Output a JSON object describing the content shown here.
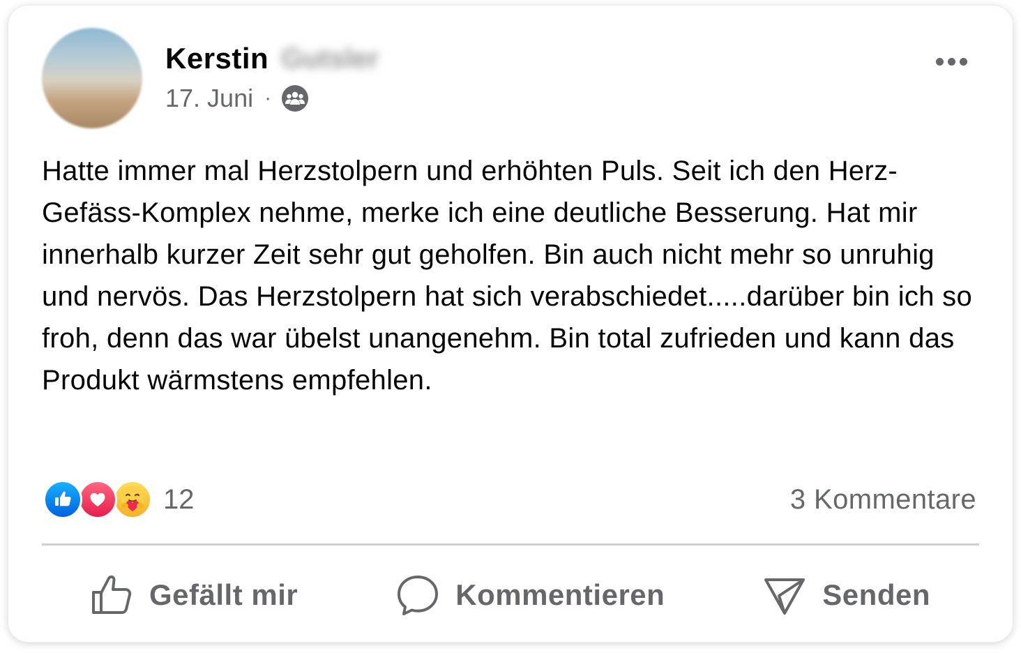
{
  "post": {
    "author_first_name": "Kerstin",
    "author_last_name_blurred": "Gutsler",
    "date": "17. Juni",
    "separator": "·",
    "privacy_icon": "group-icon",
    "more_icon": "more-horizontal-icon",
    "text": "Hatte immer mal Herzstolpern und erhöhten Puls. Seit ich den Herz-Gefäss-Komplex nehme, merke ich eine deutliche Besserung. Hat mir innerhalb kurzer Zeit sehr gut geholfen. Bin auch nicht mehr so unruhig und nervös. Das Herzstolpern hat sich verabschiedet.....darüber bin ich so froh, denn das war übelst unangenehm. Bin total zufrieden und kann das Produkt wärmstens empfehlen."
  },
  "reactions": {
    "icons": [
      "like-reaction-icon",
      "love-reaction-icon",
      "care-reaction-icon"
    ],
    "count": "12",
    "comments": "3 Kommentare"
  },
  "actions": {
    "like_label": "Gefällt mir",
    "comment_label": "Kommentieren",
    "send_label": "Senden"
  },
  "colors": {
    "text_primary": "#050505",
    "text_secondary": "#65676b",
    "like_blue": "#0866ff",
    "love_red": "#f33e58",
    "care_yellow": "#f7b125",
    "divider": "#ced0d4"
  }
}
